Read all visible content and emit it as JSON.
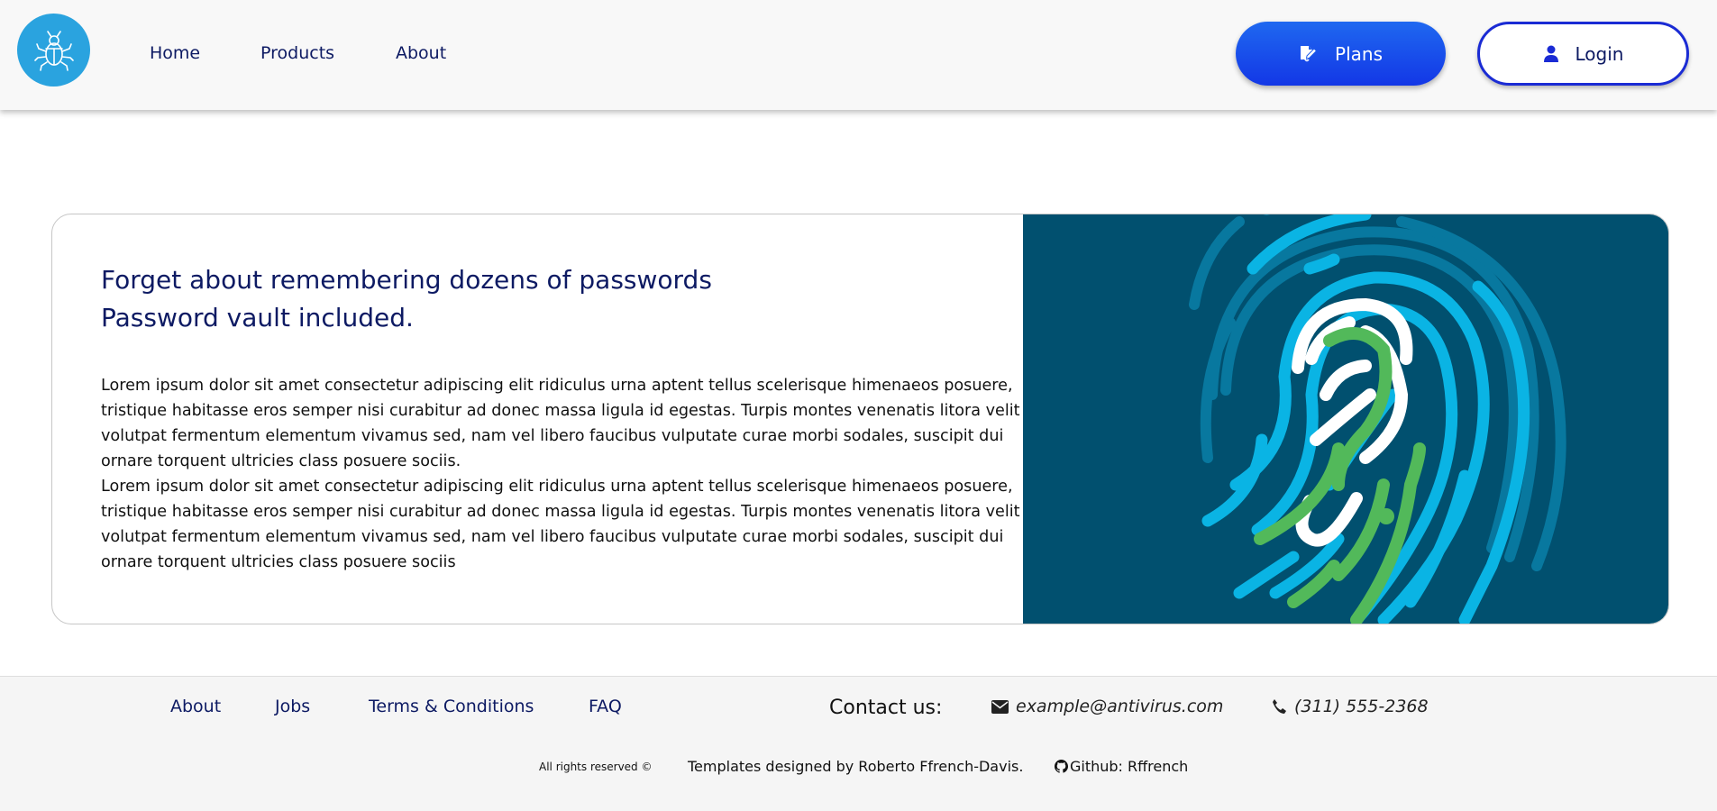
{
  "header": {
    "logo_icon": "bug-icon",
    "nav": [
      {
        "label": "Home"
      },
      {
        "label": "Products"
      },
      {
        "label": "About"
      }
    ],
    "plans_button": {
      "label": "Plans",
      "icon": "signature-icon"
    },
    "login_button": {
      "label": "Login",
      "icon": "user-icon"
    }
  },
  "hero": {
    "heading_line1": "Forget about remembering dozens of passwords",
    "heading_line2": "Password vault included.",
    "paragraph1": "Lorem ipsum dolor sit amet consectetur adipiscing elit ridiculus urna aptent tellus scelerisque himenaeos posuere, tristique habitasse eros semper nisi curabitur ad donec massa ligula id egestas. Turpis montes venenatis litora velit volutpat fermentum elementum vivamus sed, nam vel libero faucibus vulputate curae morbi sodales, suscipit dui ornare torquent ultricies class posuere sociis.",
    "paragraph2": "Lorem ipsum dolor sit amet consectetur adipiscing elit ridiculus urna aptent tellus scelerisque himenaeos posuere, tristique habitasse eros semper nisi curabitur ad donec massa ligula id egestas. Turpis montes venenatis litora velit volutpat fermentum elementum vivamus sed, nam vel libero faucibus vulputate curae morbi sodales, suscipit dui ornare torquent ultricies class posuere sociis",
    "image_icon": "fingerprint-icon"
  },
  "footer": {
    "links": [
      {
        "label": "About"
      },
      {
        "label": "Jobs"
      },
      {
        "label": "Terms & Conditions"
      },
      {
        "label": "FAQ"
      }
    ],
    "contact_label": "Contact us:",
    "email": "example@antivirus.com",
    "phone": "(311) 555-2368",
    "rights": "All rights reserved ©",
    "credits": "Templates designed by Roberto Ffrench-Davis.",
    "github": "Github: Rffrench"
  },
  "colors": {
    "nav_text": "#0d1a63",
    "plans_button": "#1337e6",
    "login_border": "#1a2bd4",
    "logo_bg": "#2aa3df",
    "image_bg": "#01506f",
    "fp_light_blue": "#0ab4e4",
    "fp_dark_blue": "#0a7fa8",
    "fp_green": "#52b95a"
  }
}
